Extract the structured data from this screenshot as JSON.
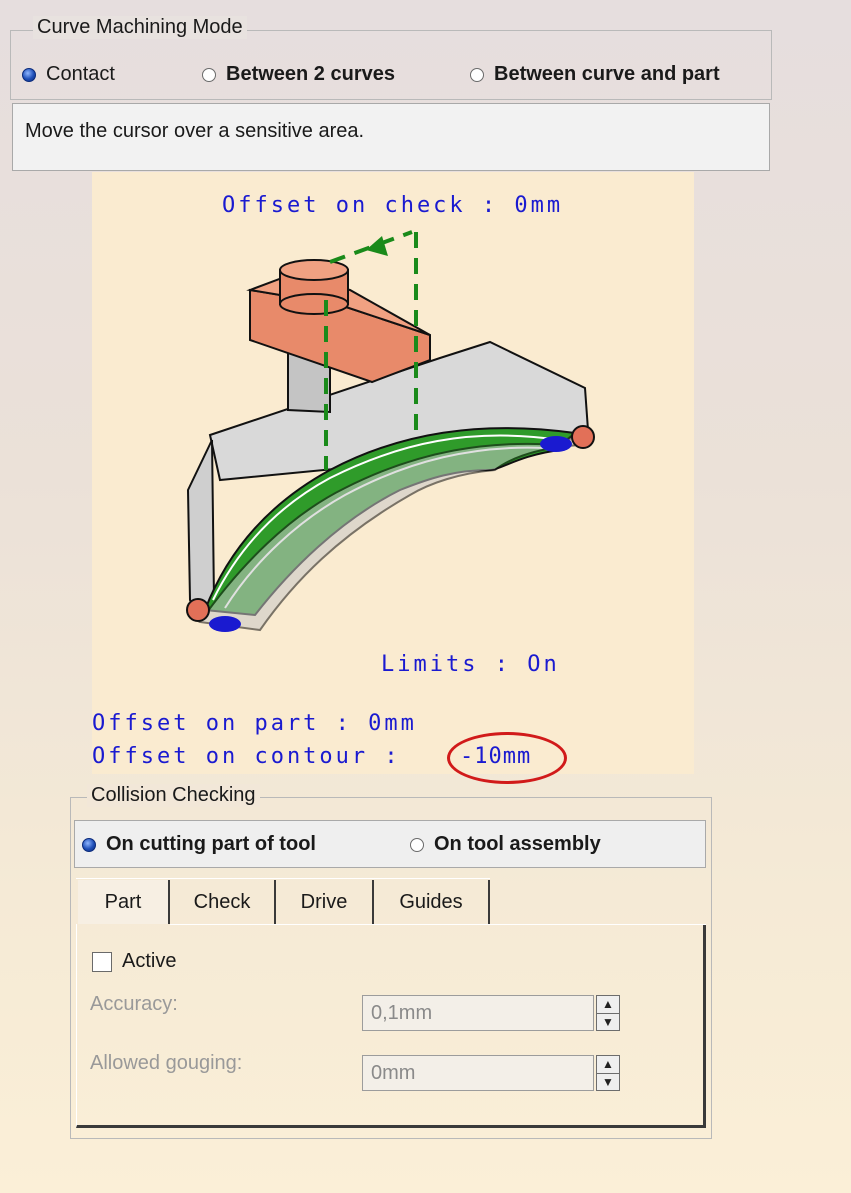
{
  "curve_mode": {
    "title": "Curve Machining Mode",
    "options": [
      {
        "label": "Contact",
        "selected": true
      },
      {
        "label": "Between 2 curves",
        "selected": false
      },
      {
        "label": "Between curve and part",
        "selected": false
      }
    ],
    "message": "Move the cursor over a sensitive area."
  },
  "diagram": {
    "offset_on_check": "Offset on check : 0mm",
    "limits": "Limits : On",
    "offset_on_part": "Offset on part : 0mm",
    "offset_on_contour_label": "Offset on contour :",
    "offset_on_contour_value": "-10mm",
    "highlight_color": "#d11a1a",
    "text_color": "#1a1ad0"
  },
  "collision": {
    "title": "Collision Checking",
    "options": [
      {
        "label": "On cutting part of tool",
        "selected": true
      },
      {
        "label": "On tool assembly",
        "selected": false
      }
    ],
    "tabs": [
      "Part",
      "Check",
      "Drive",
      "Guides"
    ],
    "active_tab": "Part",
    "active_label": "Active",
    "active_checked": false,
    "accuracy_label": "Accuracy:",
    "accuracy_value": "0,1mm",
    "gouging_label": "Allowed gouging:",
    "gouging_value": "0mm"
  }
}
